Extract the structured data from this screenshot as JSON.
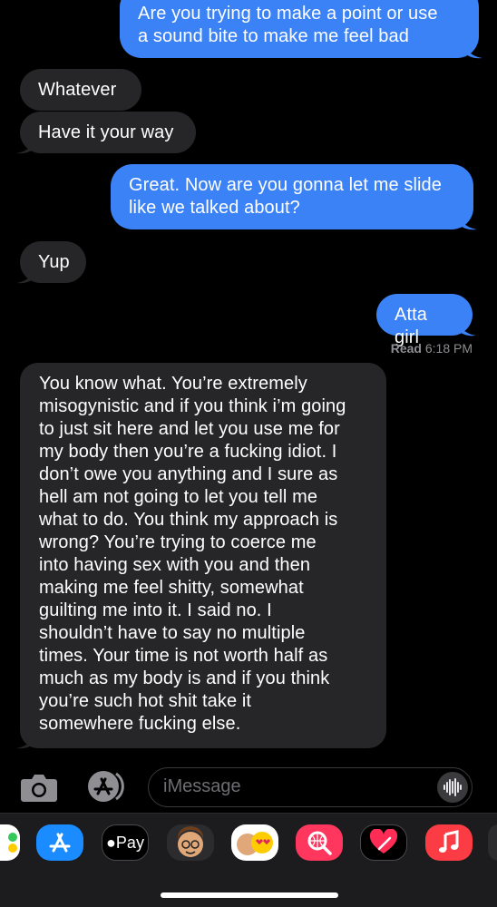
{
  "messages": [
    {
      "id": "b1",
      "direction": "outgoing",
      "text": "Are you trying to make a point or use\na sound bite to make me feel bad"
    },
    {
      "id": "b2",
      "direction": "incoming",
      "text": "Whatever"
    },
    {
      "id": "b3",
      "direction": "incoming",
      "text": "Have it your way"
    },
    {
      "id": "b4",
      "direction": "outgoing",
      "text": "Great. Now are you gonna let me slide\nlike we talked about?"
    },
    {
      "id": "b5",
      "direction": "incoming",
      "text": "Yup"
    },
    {
      "id": "b6",
      "direction": "outgoing",
      "text": "Atta girl"
    },
    {
      "id": "b7",
      "direction": "incoming",
      "text": "You know what. You’re extremely\nmisogynistic and if you think i’m going\nto just sit here and let you use me for\nmy body then you’re a fucking idiot. I\ndon’t owe you anything and I sure as\nhell am not going to let you tell me\nwhat to do. You think my approach is\nwrong? You’re trying to coerce me\ninto having sex with you and then\nmaking me feel shitty, somewhat\nguilting me into it. I said no. I\nshouldn’t have to say no multiple\ntimes.  Your time is not worth half as\nmuch as my body is and if you think\nyou’re such hot shit take it\nsomewhere fucking else."
    }
  ],
  "read_receipt": {
    "status": "Read",
    "time": "6:18 PM"
  },
  "input_bar": {
    "placeholder": "iMessage",
    "value": ""
  },
  "app_drawer": {
    "apple_pay_label": "Pay",
    "icons": [
      "photos-icon",
      "app-store-icon",
      "apple-pay-icon",
      "memoji-icon",
      "animoji-stickers-icon",
      "web-search-icon",
      "digital-touch-icon",
      "music-icon"
    ]
  },
  "colors": {
    "outgoing_bubble": "#3b82f6",
    "incoming_bubble": "#262628",
    "background": "#000000",
    "drawer": "#1c1c1e"
  }
}
